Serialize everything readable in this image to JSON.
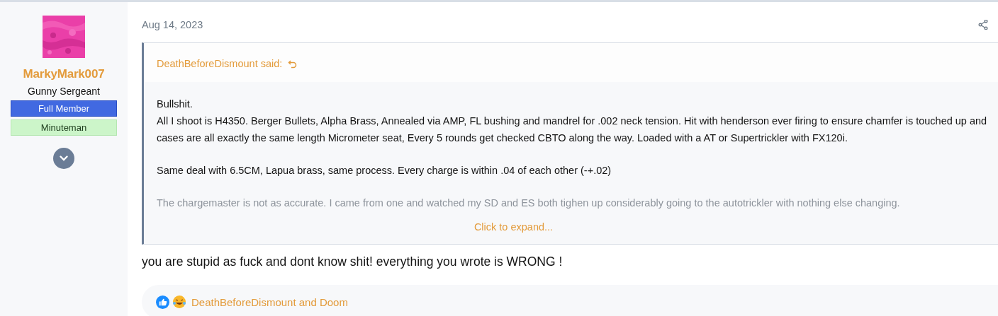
{
  "author": {
    "name": "MarkyMark007",
    "title": "Gunny Sergeant",
    "banners": [
      {
        "label": "Full Member",
        "kind": "primary"
      },
      {
        "label": "Minuteman",
        "kind": "success"
      }
    ]
  },
  "post": {
    "date": "Aug 14, 2023",
    "quote": {
      "attribution": "DeathBeforeDismount said:",
      "paragraphs": [
        {
          "text": "Bullshit.\nAll I shoot is H4350. Berger Bullets, Alpha Brass, Annealed via AMP, FL bushing and mandrel for .002 neck tension. Hit with henderson ever firing to ensure chamfer is touched up and cases are all exactly the same length Micrometer seat, Every 5 rounds get checked CBTO along the way. Loaded with a AT or Supertrickler with FX120i.",
          "faded": false
        },
        {
          "text": "Same deal with 6.5CM, Lapua brass, same process. Every charge is within .04 of each other (-+.02)",
          "faded": false
        },
        {
          "text": "The chargemaster is not as accurate. I came from one and watched my SD and ES both tighen up considerably going to the autotrickler with nothing else changing.",
          "faded": true
        }
      ],
      "expand": "Click to expand..."
    },
    "body": "you are stupid as fuck and dont know shit! everything you wrote is WRONG !",
    "reactions": {
      "icons": [
        {
          "kind": "like"
        },
        {
          "kind": "haha"
        }
      ],
      "users": "DeathBeforeDismount and Doom"
    }
  }
}
